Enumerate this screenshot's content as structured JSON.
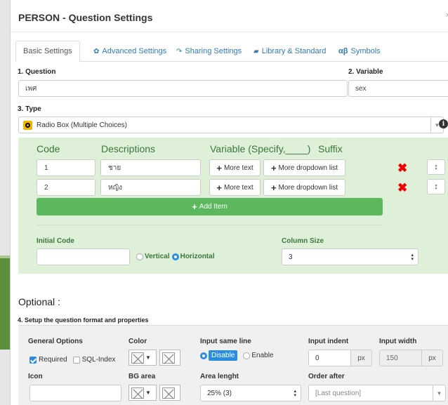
{
  "dialog": {
    "title": "PERSON - Question Settings",
    "close": "×"
  },
  "tabs": [
    {
      "label": "Basic Settings",
      "icon": ""
    },
    {
      "label": "Advanced Settings",
      "icon": "✿"
    },
    {
      "label": "Sharing Settings",
      "icon": "↷"
    },
    {
      "label": "Library & Standard",
      "icon": "▰"
    },
    {
      "label": "Symbols",
      "icon": "αβ"
    }
  ],
  "question": {
    "label": "1. Question",
    "value": "เพศ"
  },
  "variable": {
    "label": "2. Variable",
    "value": "sex"
  },
  "type": {
    "label": "3. Type",
    "value": "Radio Box (Multiple Choices)",
    "info_icon": "i"
  },
  "choices": {
    "headers": {
      "code": "Code",
      "descriptions": "Descriptions",
      "variable": "Variable (Specify,____)",
      "suffix": "Suffix"
    },
    "rows": [
      {
        "code": "1",
        "description": "ชาย"
      },
      {
        "code": "2",
        "description": "หญิง"
      }
    ],
    "more_text_label": "More text",
    "more_dropdown_label": "More dropdown list",
    "add_item_label": "Add Item",
    "delete_glyph": "✖",
    "sort_glyph": "↕"
  },
  "initial_code": {
    "label": "Initial Code",
    "value": ""
  },
  "orientation": {
    "vertical": "Vertical",
    "horizontal": "Horizontal",
    "selected": "Horizontal"
  },
  "column_size": {
    "label": "Column Size",
    "value": "3"
  },
  "optional": {
    "title": "Optional :",
    "section_label": "4. Setup the question format and properties",
    "general_options": {
      "label": "General Options",
      "required": "Required",
      "required_checked": true,
      "sql_index": "SQL-Index",
      "sql_index_checked": false
    },
    "color": {
      "label": "Color"
    },
    "input_same_line": {
      "label": "Input same line",
      "disable": "Disable",
      "enable": "Enable",
      "selected": "Disable"
    },
    "input_indent": {
      "label": "Input indent",
      "value": "0",
      "unit": "px"
    },
    "input_width": {
      "label": "Input width",
      "value": "150",
      "unit": "px"
    },
    "icon": {
      "label": "Icon",
      "value": ""
    },
    "bg_area": {
      "label": "BG area"
    },
    "area_length": {
      "label": "Area lenght",
      "value": "25% (3)"
    },
    "order_after": {
      "label": "Order after",
      "value": "[Last question]"
    }
  },
  "colors": {
    "accent": "#2a8de0",
    "green_panel": "#dff0d8",
    "add_button": "#5cb85c",
    "delete": "#ee0000"
  }
}
